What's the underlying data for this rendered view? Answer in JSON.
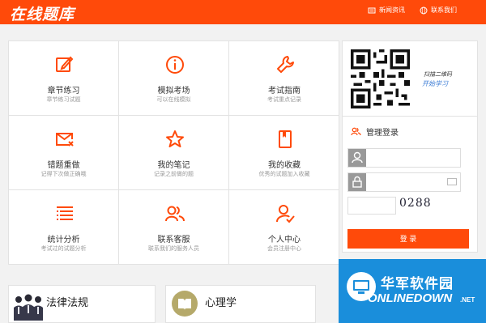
{
  "header": {
    "logo": "在线题库",
    "news_link": "新闻资讯",
    "contact_link": "联系我们"
  },
  "modules": [
    {
      "title": "章节练习",
      "subtitle": "章节练习试题",
      "icon": "edit-icon"
    },
    {
      "title": "模拟考场",
      "subtitle": "可以在线模拟",
      "icon": "info-icon"
    },
    {
      "title": "考试指南",
      "subtitle": "考试重点记录",
      "icon": "wrench-icon"
    },
    {
      "title": "错题重做",
      "subtitle": "记得下次做正确哦",
      "icon": "mail-x-icon"
    },
    {
      "title": "我的笔记",
      "subtitle": "记录之前做的题",
      "icon": "star-icon"
    },
    {
      "title": "我的收藏",
      "subtitle": "优秀的试题加入收藏",
      "icon": "bookmark-icon"
    },
    {
      "title": "统计分析",
      "subtitle": "考试过的试题分析",
      "icon": "list-icon"
    },
    {
      "title": "联系客服",
      "subtitle": "联系我们的服务人员",
      "icon": "users-icon"
    },
    {
      "title": "个人中心",
      "subtitle": "会员注册中心",
      "icon": "user-check-icon"
    }
  ],
  "sidebar": {
    "scan_text": "扫描二维码",
    "study_text": "开始学习",
    "login_title": "管理登录",
    "login_button": "登 录",
    "captcha_text": "0288"
  },
  "bottom": {
    "card1": "法律法规",
    "card2": "心理学"
  },
  "watermark": {
    "cn": "华军软件园",
    "en": "ONLINEDOWN",
    "net": ".NET"
  },
  "colors": {
    "brand": "#ff4a0a",
    "watermark_bg": "#1a8edb"
  }
}
